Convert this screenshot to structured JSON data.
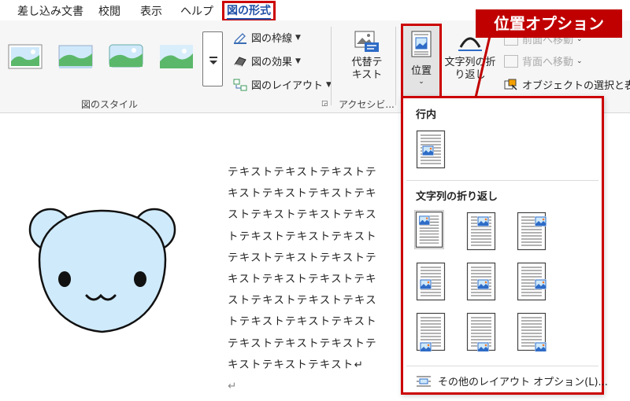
{
  "tabs": [
    {
      "label": "差し込み文書",
      "active": false
    },
    {
      "label": "校閲",
      "active": false
    },
    {
      "label": "表示",
      "active": false
    },
    {
      "label": "ヘルプ",
      "active": false
    },
    {
      "label": "図の形式",
      "active": true
    }
  ],
  "ribbon": {
    "styles_group_label": "図のスタイル",
    "border_label": "図の枠線",
    "effects_label": "図の効果",
    "layout_label": "図のレイアウト",
    "accessibility_group_label": "アクセシビ...",
    "alt_text_line1": "代替テ",
    "alt_text_line2": "キスト",
    "position_label": "位置",
    "wrap_line1": "文字列の折",
    "wrap_line2": "り返し",
    "bring_forward_label": "前面へ移動",
    "send_backward_label": "背面へ移動",
    "selection_pane_label": "オブジェクトの選択と表示"
  },
  "callout": {
    "label": "位置オプション",
    "color": "#c00000"
  },
  "dropdown": {
    "inline_header": "行内",
    "wrap_header": "文字列の折り返し",
    "more_layout_label": "その他のレイアウト オプション(L)..."
  },
  "document": {
    "lines": [
      "テキストテキストテキストテ",
      "キストテキストテキストテキ",
      "ストテキストテキストテキス",
      "トテキストテキストテキスト",
      "テキストテキストテキストテ",
      "キストテキストテキストテキ",
      "ストテキストテキストテキス",
      "トテキストテキストテキスト",
      "テキストテキストテキストテ",
      "キストテキストテキスト↵",
      "↵"
    ]
  },
  "colors": {
    "accent_red": "#cc0000",
    "active_tab": "#1f4fa6",
    "bear_fill": "#cfeafb"
  }
}
